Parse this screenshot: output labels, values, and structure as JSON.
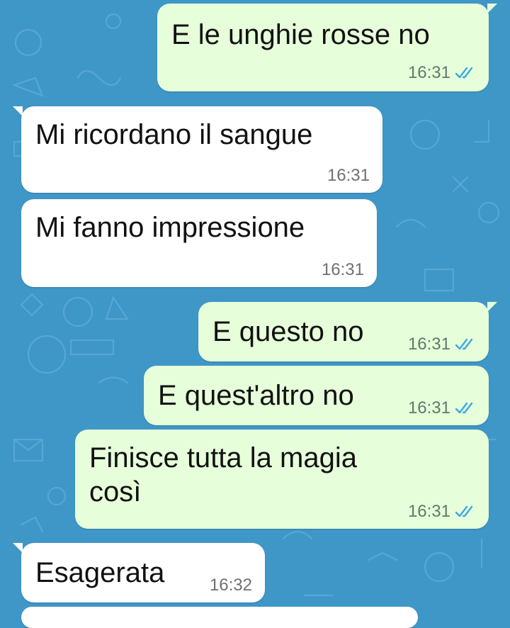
{
  "messages": [
    {
      "id": "m1",
      "direction": "outgoing",
      "text": "E le unghie rosse no",
      "time": "16:31",
      "status_icon": "double-check-read-icon"
    },
    {
      "id": "m2",
      "direction": "incoming",
      "text": "Mi ricordano il sangue",
      "time": "16:31"
    },
    {
      "id": "m3",
      "direction": "incoming",
      "text": "Mi fanno impressione",
      "time": "16:31"
    },
    {
      "id": "m4",
      "direction": "outgoing",
      "text": "E questo no",
      "time": "16:31",
      "status_icon": "double-check-read-icon"
    },
    {
      "id": "m5",
      "direction": "outgoing",
      "text": "E quest'altro no",
      "time": "16:31",
      "status_icon": "double-check-read-icon"
    },
    {
      "id": "m6",
      "direction": "outgoing",
      "text": "Finisce tutta la magia così",
      "time": "16:31",
      "status_icon": "double-check-read-icon"
    },
    {
      "id": "m7",
      "direction": "incoming",
      "text": "Esagerata",
      "time": "16:32"
    }
  ],
  "colors": {
    "wallpaper": "#3f97c7",
    "outgoing_bubble": "#e6ffda",
    "incoming_bubble": "#ffffff",
    "read_ticks": "#3ba9e6"
  }
}
